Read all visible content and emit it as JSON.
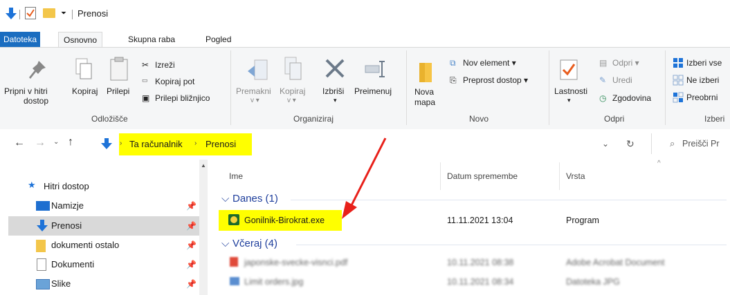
{
  "window": {
    "title": "Prenosi"
  },
  "tabs": [
    "Datoteka",
    "Osnovno",
    "Skupna raba",
    "Pogled"
  ],
  "ribbon": {
    "clipboard": {
      "pin_line1": "Pripni v hitri",
      "pin_line2": "dostop",
      "copy": "Kopiraj",
      "paste": "Prilepi",
      "cut": "Izreži",
      "copy_path": "Kopiraj pot",
      "paste_shortcut": "Prilepi bližnjico",
      "label": "Odložišče"
    },
    "organize": {
      "move": "Premakni",
      "move_sub": "v ▾",
      "copy_to": "Kopiraj",
      "copy_to_sub": "v ▾",
      "delete": "Izbriši",
      "rename": "Preimenuj",
      "label": "Organiziraj"
    },
    "new": {
      "folder_line1": "Nova",
      "folder_line2": "mapa",
      "new_item": "Nov element ▾",
      "easy_access": "Preprost dostop ▾",
      "label": "Novo"
    },
    "open": {
      "properties": "Lastnosti",
      "open": "Odpri ▾",
      "edit": "Uredi",
      "history": "Zgodovina",
      "label": "Odpri"
    },
    "select": {
      "select_all": "Izberi vse",
      "select_none": "Ne izberi",
      "invert": "Preobrni",
      "label": "Izberi"
    }
  },
  "address": {
    "crumb1": "Ta računalnik",
    "crumb2": "Prenosi",
    "search_placeholder": "Preišči Pr"
  },
  "nav": {
    "quick_access": "Hitri dostop",
    "items": [
      "Namizje",
      "Prenosi",
      "dokumenti ostalo",
      "Dokumenti",
      "Slike"
    ]
  },
  "columns": {
    "name": "Ime",
    "date": "Datum spremembe",
    "type": "Vrsta"
  },
  "groups": {
    "today": "Danes (1)",
    "yesterday": "Včeraj (4)"
  },
  "files": [
    {
      "name": "Gonilnik-Birokrat.exe",
      "date": "11.11.2021 13:04",
      "type": "Program"
    },
    {
      "name": "japonske-svecke-visnci.pdf",
      "date": "10.11.2021 08:38",
      "type": "Adobe Acrobat Document"
    },
    {
      "name": "Limit orders.jpg",
      "date": "10.11.2021 08:34",
      "type": "Datoteka JPG"
    }
  ],
  "colors": {
    "accent": "#1a6dc0",
    "highlight": "#ffff00",
    "annotation": "#e8201a"
  }
}
